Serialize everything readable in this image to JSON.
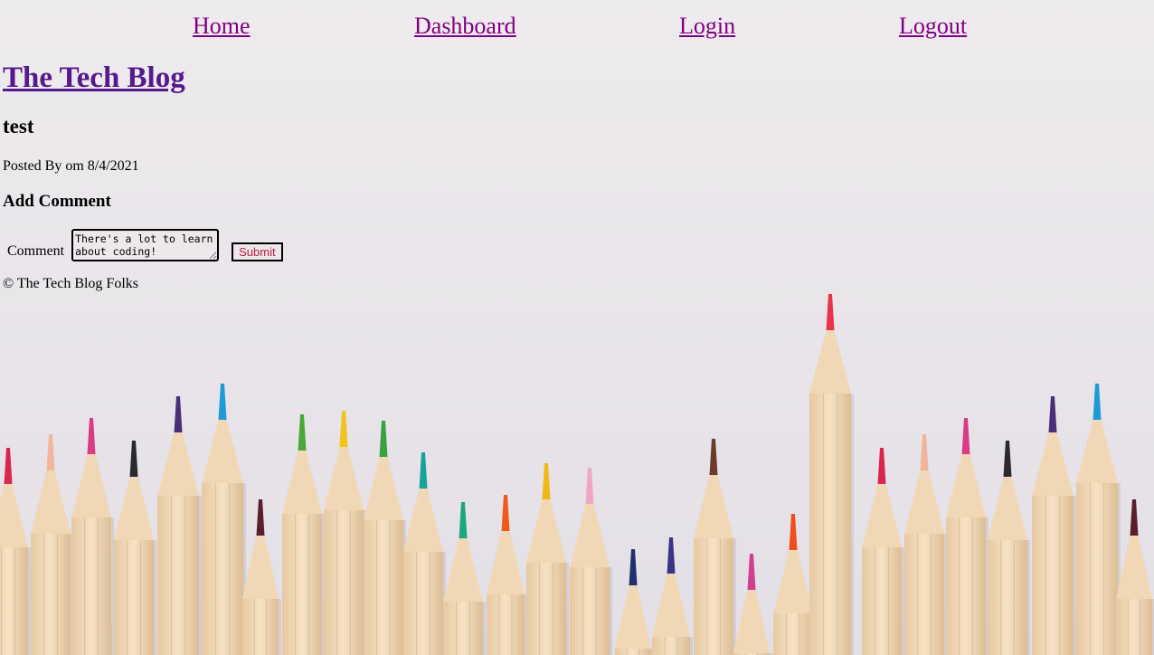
{
  "nav": {
    "home": "Home",
    "dashboard": "Dashboard",
    "login": "Login",
    "logout": "Logout"
  },
  "site": {
    "title": "The Tech Blog"
  },
  "post": {
    "title": "test",
    "meta": "Posted By om 8/4/2021"
  },
  "comment_form": {
    "heading": "Add Comment",
    "label": "Comment",
    "value": "There's a lot to learn about coding!",
    "submit_label": "Submit"
  },
  "footer": {
    "text": "© The Tech Blog Folks"
  },
  "colors": {
    "link_visited": "#800080",
    "title_link": "#551a8b",
    "submit_text": "#b32046",
    "background": "#e9e5ea"
  }
}
